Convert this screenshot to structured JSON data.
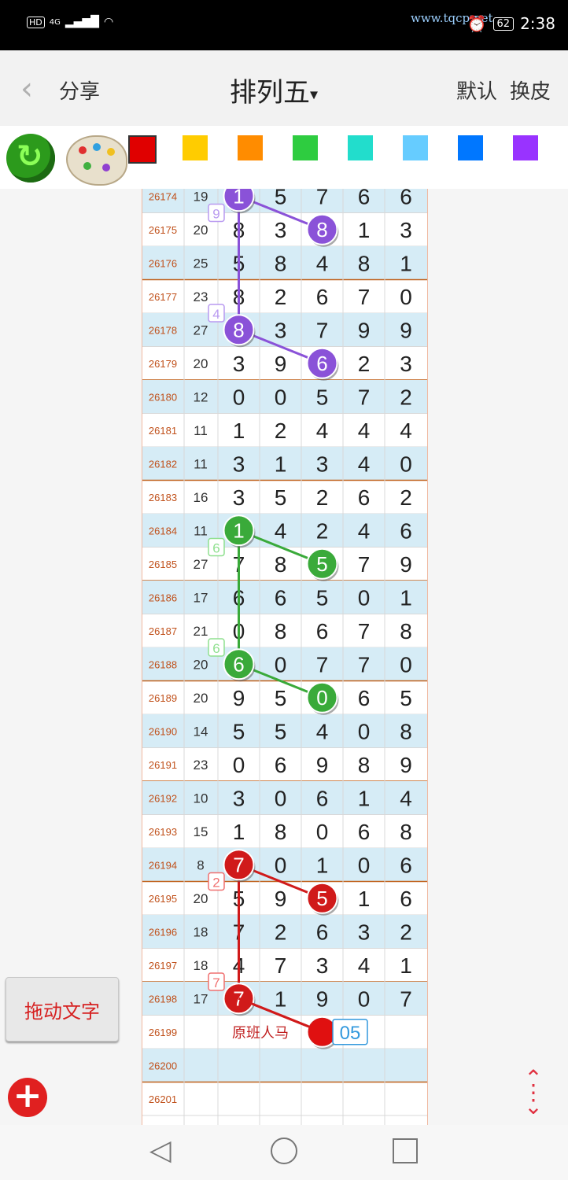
{
  "status": {
    "network": "4G",
    "hd": "HD",
    "battery": "62",
    "time": "2:38",
    "watermark": "www.tqcp.net"
  },
  "nav": {
    "back": "‹",
    "share": "分享",
    "title": "排列五",
    "title_arrow": "▾",
    "default": "默认",
    "skin": "换皮"
  },
  "toolbar": {
    "colors": [
      "#e00000",
      "#ffcc00",
      "#ff8c00",
      "#2ecc40",
      "#22ddcc",
      "#66ccff",
      "#0077ff",
      "#9933ff"
    ]
  },
  "rows": [
    {
      "id": "26174",
      "sum": "19",
      "d": [
        "1",
        "5",
        "7",
        "6",
        "6"
      ]
    },
    {
      "id": "26175",
      "sum": "20",
      "d": [
        "8",
        "3",
        "8",
        "1",
        "3"
      ]
    },
    {
      "id": "26176",
      "sum": "25",
      "d": [
        "5",
        "8",
        "4",
        "8",
        "1"
      ]
    },
    {
      "id": "26177",
      "sum": "23",
      "d": [
        "8",
        "2",
        "6",
        "7",
        "0"
      ]
    },
    {
      "id": "26178",
      "sum": "27",
      "d": [
        "8",
        "3",
        "7",
        "9",
        "9"
      ]
    },
    {
      "id": "26179",
      "sum": "20",
      "d": [
        "3",
        "9",
        "6",
        "2",
        "3"
      ]
    },
    {
      "id": "26180",
      "sum": "12",
      "d": [
        "0",
        "0",
        "5",
        "7",
        "2"
      ]
    },
    {
      "id": "26181",
      "sum": "11",
      "d": [
        "1",
        "2",
        "4",
        "4",
        "4"
      ]
    },
    {
      "id": "26182",
      "sum": "11",
      "d": [
        "3",
        "1",
        "3",
        "4",
        "0"
      ]
    },
    {
      "id": "26183",
      "sum": "16",
      "d": [
        "3",
        "5",
        "2",
        "6",
        "2"
      ]
    },
    {
      "id": "26184",
      "sum": "11",
      "d": [
        "1",
        "4",
        "2",
        "4",
        "6"
      ]
    },
    {
      "id": "26185",
      "sum": "27",
      "d": [
        "7",
        "8",
        "5",
        "7",
        "9"
      ]
    },
    {
      "id": "26186",
      "sum": "17",
      "d": [
        "6",
        "6",
        "5",
        "0",
        "1"
      ]
    },
    {
      "id": "26187",
      "sum": "21",
      "d": [
        "0",
        "8",
        "6",
        "7",
        "8"
      ]
    },
    {
      "id": "26188",
      "sum": "20",
      "d": [
        "6",
        "0",
        "7",
        "7",
        "0"
      ]
    },
    {
      "id": "26189",
      "sum": "20",
      "d": [
        "9",
        "5",
        "0",
        "6",
        "5"
      ]
    },
    {
      "id": "26190",
      "sum": "14",
      "d": [
        "5",
        "5",
        "4",
        "0",
        "8"
      ]
    },
    {
      "id": "26191",
      "sum": "23",
      "d": [
        "0",
        "6",
        "9",
        "8",
        "9"
      ]
    },
    {
      "id": "26192",
      "sum": "10",
      "d": [
        "3",
        "0",
        "6",
        "1",
        "4"
      ]
    },
    {
      "id": "26193",
      "sum": "15",
      "d": [
        "1",
        "8",
        "0",
        "6",
        "8"
      ]
    },
    {
      "id": "26194",
      "sum": "8",
      "d": [
        "7",
        "0",
        "1",
        "0",
        "6"
      ]
    },
    {
      "id": "26195",
      "sum": "20",
      "d": [
        "5",
        "9",
        "5",
        "1",
        "6"
      ]
    },
    {
      "id": "26196",
      "sum": "18",
      "d": [
        "7",
        "2",
        "6",
        "3",
        "2"
      ]
    },
    {
      "id": "26197",
      "sum": "18",
      "d": [
        "4",
        "7",
        "3",
        "4",
        "1"
      ]
    },
    {
      "id": "26198",
      "sum": "17",
      "d": [
        "7",
        "1",
        "9",
        "0",
        "7"
      ]
    },
    {
      "id": "26199",
      "sum": "",
      "d": [
        "",
        "",
        "",
        "",
        ""
      ]
    },
    {
      "id": "26200",
      "sum": "",
      "d": [
        "",
        "",
        "",
        "",
        ""
      ]
    },
    {
      "id": "26201",
      "sum": "",
      "d": [
        "",
        "",
        "",
        "",
        ""
      ]
    }
  ],
  "annotations": {
    "groups": [
      {
        "color": "#8a52d8",
        "light": "#b99af0",
        "points": [
          [
            0,
            0
          ],
          [
            1,
            2
          ],
          [
            4,
            0
          ],
          [
            5,
            2
          ]
        ],
        "labels": [
          {
            "row": 0.5,
            "text": "9"
          },
          {
            "row": 3.5,
            "text": "4"
          }
        ]
      },
      {
        "color": "#3aaa3a",
        "light": "#8fe08f",
        "points": [
          [
            10,
            0
          ],
          [
            11,
            2
          ],
          [
            14,
            0
          ],
          [
            15,
            2
          ]
        ],
        "labels": [
          {
            "row": 10.5,
            "text": "6"
          },
          {
            "row": 13.5,
            "text": "6"
          }
        ]
      },
      {
        "color": "#d01a1a",
        "light": "#f07070",
        "points": [
          [
            20,
            0
          ],
          [
            21,
            2
          ],
          [
            24,
            0
          ],
          [
            25,
            2
          ]
        ],
        "labels": [
          {
            "row": 20.5,
            "text": "2"
          },
          {
            "row": 23.5,
            "text": "7"
          }
        ]
      }
    ],
    "note_text": "原班人马",
    "prediction": "05"
  },
  "buttons": {
    "drag_text": "拖动文字",
    "add": "+"
  },
  "scroll": {
    "up": "⌃",
    "dots": "⋮",
    "down": "⌄"
  },
  "sysnav": {
    "back": "◁"
  }
}
